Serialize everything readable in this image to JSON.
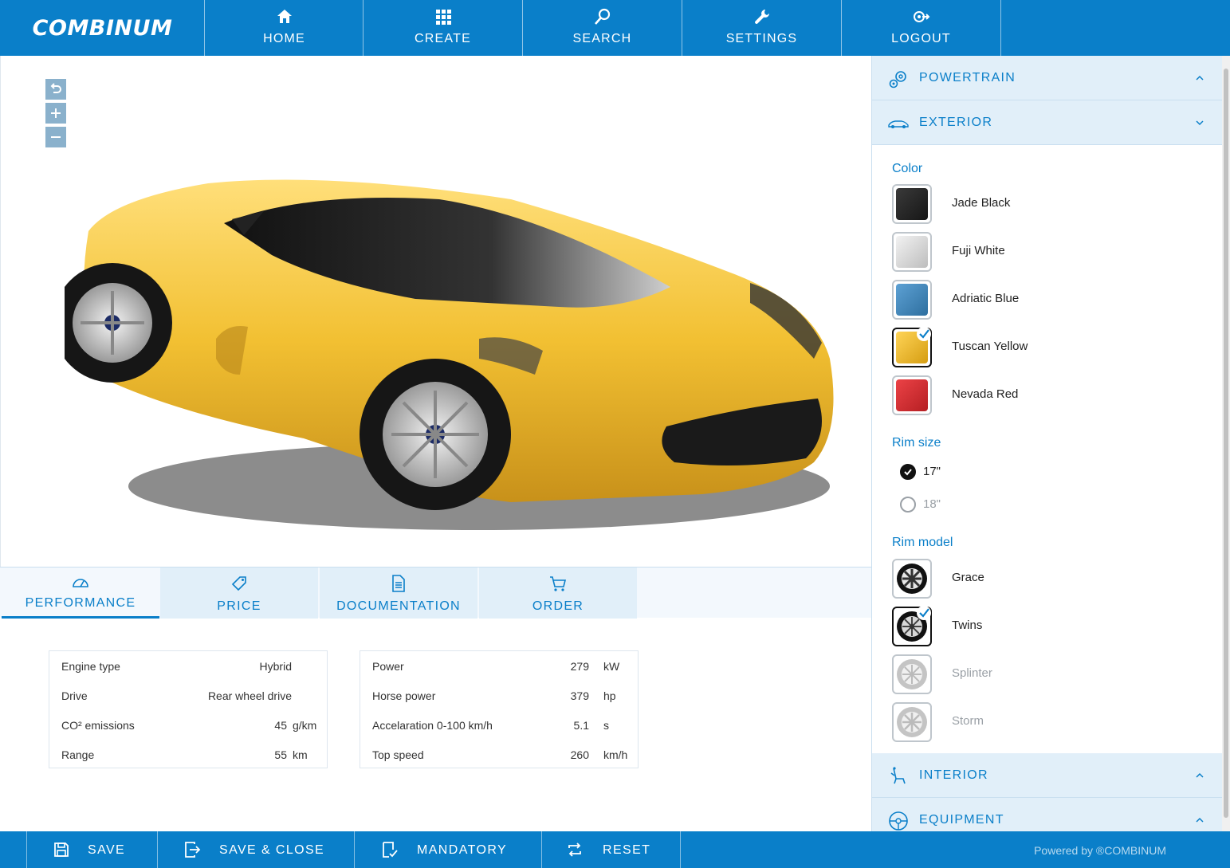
{
  "app": {
    "logo_text": "COMBINUM"
  },
  "nav": {
    "items": [
      {
        "label": "HOME",
        "icon": "home-icon"
      },
      {
        "label": "CREATE",
        "icon": "grid-icon"
      },
      {
        "label": "SEARCH",
        "icon": "search-icon"
      },
      {
        "label": "SETTINGS",
        "icon": "wrench-icon"
      },
      {
        "label": "LOGOUT",
        "icon": "logout-icon"
      }
    ]
  },
  "viewer": {
    "controls": [
      {
        "icon": "undo-icon",
        "glyph": "↺"
      },
      {
        "icon": "zoom-in-icon",
        "glyph": "+"
      },
      {
        "icon": "zoom-out-icon",
        "glyph": "−"
      }
    ],
    "car_color": "#f2c032"
  },
  "tabs": [
    {
      "label": "PERFORMANCE",
      "icon": "gauge-icon",
      "active": true
    },
    {
      "label": "PRICE",
      "icon": "price-tag-icon",
      "active": false
    },
    {
      "label": "DOCUMENTATION",
      "icon": "document-icon",
      "active": false
    },
    {
      "label": "ORDER",
      "icon": "cart-icon",
      "active": false
    }
  ],
  "specs_left": {
    "rows": [
      {
        "label": "Engine type",
        "value": "Hybrid",
        "unit": ""
      },
      {
        "label": "Drive",
        "value": "Rear wheel drive",
        "unit": ""
      },
      {
        "label": "CO² emissions",
        "value": "45",
        "unit": "g/km"
      },
      {
        "label": "Range",
        "value": "55",
        "unit": "km"
      }
    ]
  },
  "specs_right": {
    "rows": [
      {
        "label": "Power",
        "value": "279",
        "unit": "kW"
      },
      {
        "label": "Horse power",
        "value": "379",
        "unit": "hp"
      },
      {
        "label": "Accelaration 0-100 km/h",
        "value": "5.1",
        "unit": "s"
      },
      {
        "label": "Top speed",
        "value": "260",
        "unit": "km/h"
      }
    ]
  },
  "sidebar": {
    "sections": {
      "powertrain": {
        "label": "POWERTRAIN",
        "icon": "gears-icon",
        "expanded": false
      },
      "exterior": {
        "label": "EXTERIOR",
        "icon": "car-icon",
        "expanded": true
      },
      "interior": {
        "label": "INTERIOR",
        "icon": "seat-icon",
        "expanded": false
      },
      "equipment": {
        "label": "EQUIPMENT",
        "icon": "steering-wheel-icon",
        "expanded": false
      }
    },
    "color": {
      "title": "Color",
      "options": [
        {
          "name": "Jade Black",
          "hex": "#262626",
          "selected": false
        },
        {
          "name": "Fuji White",
          "hex": "#d8d8d8",
          "selected": false
        },
        {
          "name": "Adriatic Blue",
          "hex": "#3f87bf",
          "selected": false
        },
        {
          "name": "Tuscan Yellow",
          "hex": "#e9b52a",
          "selected": true
        },
        {
          "name": "Nevada Red",
          "hex": "#cf2a2e",
          "selected": false
        }
      ]
    },
    "rim_size": {
      "title": "Rim size",
      "options": [
        {
          "name": "17\"",
          "selected": true,
          "enabled": true
        },
        {
          "name": "18\"",
          "selected": false,
          "enabled": false
        }
      ]
    },
    "rim_model": {
      "title": "Rim model",
      "options": [
        {
          "name": "Grace",
          "selected": false,
          "enabled": true
        },
        {
          "name": "Twins",
          "selected": true,
          "enabled": true
        },
        {
          "name": "Splinter",
          "selected": false,
          "enabled": false
        },
        {
          "name": "Storm",
          "selected": false,
          "enabled": false
        }
      ]
    }
  },
  "footer": {
    "buttons": [
      {
        "label": "SAVE",
        "icon": "floppy-icon"
      },
      {
        "label": "SAVE & CLOSE",
        "icon": "exit-icon"
      },
      {
        "label": "MANDATORY",
        "icon": "mandatory-doc-icon"
      },
      {
        "label": "RESET",
        "icon": "refresh-icon"
      }
    ],
    "powered_by": "Powered by ®COMBINUM"
  },
  "colors": {
    "brand": "#0a7fc9",
    "tab_bg": "#e1eff9",
    "accent_check": "#0a7fc9"
  }
}
